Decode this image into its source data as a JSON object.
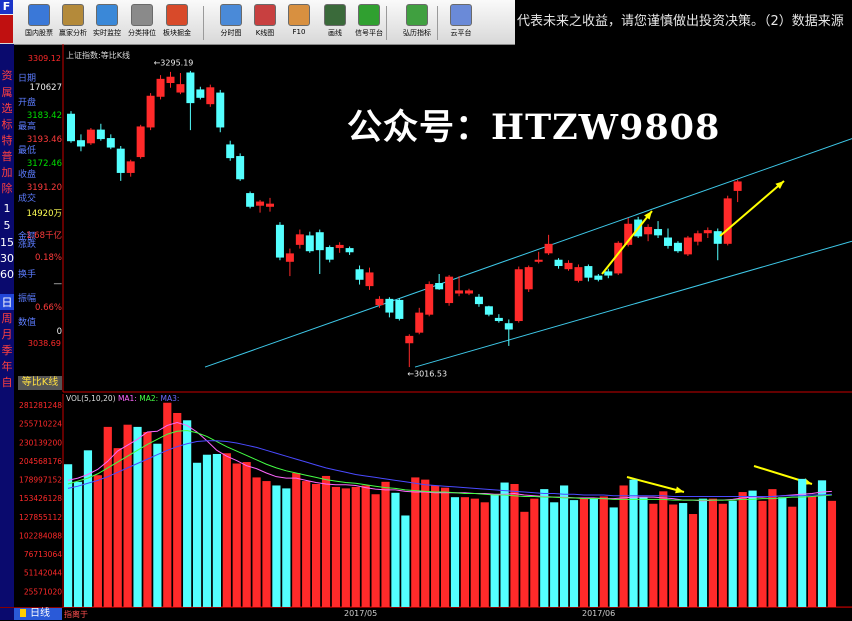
{
  "toolbar": {
    "buttons": [
      {
        "label": "国内股票",
        "icon": "monitor-icon"
      },
      {
        "label": "赢家分析",
        "icon": "calculator-icon"
      },
      {
        "label": "实时监控",
        "icon": "clock-icon"
      },
      {
        "label": "分类排位",
        "icon": "list-icon"
      },
      {
        "label": "板块掘金",
        "icon": "sector-icon"
      },
      {
        "label": "分时图",
        "icon": "intraday-icon"
      },
      {
        "label": "K线图",
        "icon": "candle-icon"
      },
      {
        "label": "F10",
        "icon": "document-icon"
      },
      {
        "label": "画线",
        "icon": "pencil-icon"
      },
      {
        "label": "信号平台",
        "icon": "traffic-light-icon"
      },
      {
        "label": "弘历指标",
        "icon": "indicator-icon"
      },
      {
        "label": "云平台",
        "icon": "cloud-icon"
      }
    ]
  },
  "ticker": "代表未来之收益，请您谨慎做出投资决策。（2）数据来源",
  "leftbar": {
    "items": [
      "资",
      "属",
      "选",
      "标",
      "特",
      "普",
      "加",
      "除",
      "1",
      "5",
      "15",
      "30",
      "60",
      "日",
      "周",
      "月",
      "季",
      "年",
      "自"
    ]
  },
  "info": {
    "labels": [
      "日期",
      "开盘",
      "最高",
      "最低",
      "收盘",
      "成交",
      "金额",
      "涨跌",
      "换手",
      "振幅",
      "数值"
    ],
    "date": "170627",
    "open": "3183.42",
    "high": "3193.46",
    "low": "3172.46",
    "close": "3191.20",
    "volume": "14920万",
    "amount": "1.68千亿",
    "change_pct": "0.18%",
    "turnover": "—",
    "amplitude": "0.66%",
    "value": "0"
  },
  "tabs": {
    "equal_ratio": "等比K线",
    "day": "日线",
    "bottom_label": "指离于"
  },
  "watermark": "公众号：HTZW9808",
  "chart_data": [
    {
      "type": "candlestick",
      "title": "上证指数:等比K线",
      "y_ticks": [
        "3309.12",
        "3038.69"
      ],
      "ylim": [
        3000,
        3309.12
      ],
      "annotations": [
        "3295.19",
        "3016.53"
      ],
      "x_ticks": [
        "2017/05",
        "2017/06"
      ],
      "candles": [
        {
          "o": 3255,
          "h": 3258,
          "l": 3228,
          "c": 3230
        },
        {
          "o": 3230,
          "h": 3236,
          "l": 3220,
          "c": 3225
        },
        {
          "o": 3228,
          "h": 3242,
          "l": 3226,
          "c": 3240
        },
        {
          "o": 3240,
          "h": 3246,
          "l": 3230,
          "c": 3232
        },
        {
          "o": 3232,
          "h": 3236,
          "l": 3222,
          "c": 3224
        },
        {
          "o": 3222,
          "h": 3225,
          "l": 3192,
          "c": 3200
        },
        {
          "o": 3200,
          "h": 3212,
          "l": 3196,
          "c": 3210
        },
        {
          "o": 3215,
          "h": 3245,
          "l": 3213,
          "c": 3243
        },
        {
          "o": 3243,
          "h": 3275,
          "l": 3240,
          "c": 3272
        },
        {
          "o": 3272,
          "h": 3292,
          "l": 3269,
          "c": 3288
        },
        {
          "o": 3285,
          "h": 3295,
          "l": 3280,
          "c": 3290
        },
        {
          "o": 3276,
          "h": 3294,
          "l": 3274,
          "c": 3283
        },
        {
          "o": 3294,
          "h": 3296,
          "l": 3240,
          "c": 3266
        },
        {
          "o": 3278,
          "h": 3281,
          "l": 3269,
          "c": 3271
        },
        {
          "o": 3265,
          "h": 3283,
          "l": 3262,
          "c": 3280
        },
        {
          "o": 3275,
          "h": 3278,
          "l": 3238,
          "c": 3243
        },
        {
          "o": 3226,
          "h": 3230,
          "l": 3211,
          "c": 3214
        },
        {
          "o": 3215,
          "h": 3218,
          "l": 3192,
          "c": 3194
        },
        {
          "o": 3180,
          "h": 3182,
          "l": 3166,
          "c": 3168
        },
        {
          "o": 3169,
          "h": 3174,
          "l": 3162,
          "c": 3172
        },
        {
          "o": 3168,
          "h": 3176,
          "l": 3163,
          "c": 3170
        },
        {
          "o": 3150,
          "h": 3153,
          "l": 3117,
          "c": 3120
        },
        {
          "o": 3116,
          "h": 3128,
          "l": 3102,
          "c": 3123
        },
        {
          "o": 3132,
          "h": 3146,
          "l": 3128,
          "c": 3141
        },
        {
          "o": 3140,
          "h": 3144,
          "l": 3124,
          "c": 3126
        },
        {
          "o": 3143,
          "h": 3146,
          "l": 3104,
          "c": 3127
        },
        {
          "o": 3129,
          "h": 3131,
          "l": 3115,
          "c": 3118
        },
        {
          "o": 3129,
          "h": 3134,
          "l": 3124,
          "c": 3131
        },
        {
          "o": 3128,
          "h": 3130,
          "l": 3122,
          "c": 3125
        },
        {
          "o": 3108,
          "h": 3112,
          "l": 3094,
          "c": 3099
        },
        {
          "o": 3093,
          "h": 3110,
          "l": 3089,
          "c": 3105
        },
        {
          "o": 3075,
          "h": 3083,
          "l": 3072,
          "c": 3080
        },
        {
          "o": 3080,
          "h": 3082,
          "l": 3063,
          "c": 3068
        },
        {
          "o": 3079,
          "h": 3081,
          "l": 3060,
          "c": 3062
        },
        {
          "o": 3039,
          "h": 3047,
          "l": 3016,
          "c": 3045
        },
        {
          "o": 3049,
          "h": 3072,
          "l": 3047,
          "c": 3067
        },
        {
          "o": 3066,
          "h": 3097,
          "l": 3064,
          "c": 3094
        },
        {
          "o": 3095,
          "h": 3104,
          "l": 3089,
          "c": 3090
        },
        {
          "o": 3077,
          "h": 3103,
          "l": 3074,
          "c": 3101
        },
        {
          "o": 3086,
          "h": 3102,
          "l": 3083,
          "c": 3088
        },
        {
          "o": 3086,
          "h": 3090,
          "l": 3084,
          "c": 3088
        },
        {
          "o": 3082,
          "h": 3085,
          "l": 3073,
          "c": 3076
        },
        {
          "o": 3073,
          "h": 3074,
          "l": 3064,
          "c": 3066
        },
        {
          "o": 3062,
          "h": 3066,
          "l": 3058,
          "c": 3060
        },
        {
          "o": 3057,
          "h": 3061,
          "l": 3036,
          "c": 3052
        },
        {
          "o": 3060,
          "h": 3111,
          "l": 3058,
          "c": 3108
        },
        {
          "o": 3090,
          "h": 3112,
          "l": 3087,
          "c": 3110
        },
        {
          "o": 3116,
          "h": 3125,
          "l": 3114,
          "c": 3117
        },
        {
          "o": 3124,
          "h": 3141,
          "l": 3122,
          "c": 3132
        },
        {
          "o": 3117,
          "h": 3119,
          "l": 3109,
          "c": 3112
        },
        {
          "o": 3109,
          "h": 3117,
          "l": 3107,
          "c": 3114
        },
        {
          "o": 3098,
          "h": 3113,
          "l": 3096,
          "c": 3110
        },
        {
          "o": 3111,
          "h": 3113,
          "l": 3097,
          "c": 3101
        },
        {
          "o": 3102,
          "h": 3104,
          "l": 3097,
          "c": 3099
        },
        {
          "o": 3106,
          "h": 3109,
          "l": 3100,
          "c": 3103
        },
        {
          "o": 3105,
          "h": 3135,
          "l": 3103,
          "c": 3133
        },
        {
          "o": 3132,
          "h": 3157,
          "l": 3130,
          "c": 3151
        },
        {
          "o": 3155,
          "h": 3158,
          "l": 3138,
          "c": 3140
        },
        {
          "o": 3142,
          "h": 3151,
          "l": 3135,
          "c": 3148
        },
        {
          "o": 3146,
          "h": 3154,
          "l": 3138,
          "c": 3141
        },
        {
          "o": 3138,
          "h": 3147,
          "l": 3128,
          "c": 3131
        },
        {
          "o": 3133,
          "h": 3135,
          "l": 3124,
          "c": 3126
        },
        {
          "o": 3123,
          "h": 3140,
          "l": 3121,
          "c": 3138
        },
        {
          "o": 3135,
          "h": 3145,
          "l": 3131,
          "c": 3142
        },
        {
          "o": 3143,
          "h": 3148,
          "l": 3138,
          "c": 3145
        },
        {
          "o": 3144,
          "h": 3147,
          "l": 3117,
          "c": 3133
        },
        {
          "o": 3133,
          "h": 3178,
          "l": 3131,
          "c": 3175
        },
        {
          "o": 3183,
          "h": 3193,
          "l": 3172,
          "c": 3191
        }
      ],
      "channel": {
        "upper": [
          [
            3038,
            3038
          ],
          [
            852,
            3232
          ]
        ],
        "lower": [
          [
            3038,
            3016
          ],
          [
            852,
            3155
          ]
        ]
      }
    },
    {
      "type": "bar",
      "title": "VOL(5,10,20)",
      "series_names": [
        "MA1",
        "MA2",
        "MA3"
      ],
      "y_ticks": [
        "281281248",
        "255710224",
        "230139200",
        "204568176",
        "178997152",
        "153426128",
        "127855112",
        "102284088",
        "76713064",
        "51142044",
        "25571020"
      ],
      "ylim": [
        0,
        281281248
      ],
      "values": [
        195,
        171,
        214,
        180,
        246,
        217,
        249,
        246,
        239,
        223,
        279,
        265,
        255,
        197,
        208,
        209,
        210,
        196,
        198,
        177,
        172,
        166,
        162,
        183,
        172,
        168,
        179,
        164,
        162,
        164,
        166,
        154,
        171,
        156,
        125,
        177,
        174,
        166,
        163,
        150,
        150,
        148,
        143,
        153,
        170,
        168,
        130,
        148,
        161,
        143,
        166,
        146,
        148,
        149,
        151,
        136,
        166,
        174,
        150,
        141,
        158,
        140,
        142,
        127,
        148,
        148,
        141,
        145,
        157,
        159,
        145,
        161,
        150,
        137,
        175,
        151,
        173,
        145
      ],
      "up": [
        false,
        false,
        false,
        true,
        true,
        true,
        true,
        false,
        true,
        false,
        true,
        true,
        false,
        false,
        false,
        false,
        true,
        true,
        true,
        true,
        true,
        false,
        false,
        true,
        true,
        true,
        true,
        true,
        true,
        true,
        true,
        true,
        true,
        false,
        false,
        true,
        true,
        true,
        true,
        false,
        true,
        true,
        true,
        false,
        false,
        true,
        true,
        true,
        false,
        false,
        false,
        false,
        true,
        false,
        true,
        false,
        true,
        false,
        false,
        true,
        true,
        true,
        false,
        true,
        false,
        true,
        true,
        false,
        true,
        false,
        true,
        true,
        false,
        true,
        false,
        true,
        false,
        true
      ],
      "ma": {
        "MA1": [
          173,
          176,
          181,
          188,
          199,
          213,
          221,
          229,
          239,
          240,
          248,
          252,
          248,
          239,
          227,
          214,
          206,
          200,
          193,
          189,
          183,
          178,
          176,
          176,
          173,
          170,
          168,
          167,
          167,
          166,
          163,
          161,
          160,
          160,
          158,
          157,
          157,
          156,
          156,
          156,
          156,
          155,
          155,
          154,
          154,
          155,
          153,
          152,
          151,
          150,
          150,
          149,
          149,
          149,
          148,
          148,
          149,
          150,
          150,
          150,
          149,
          148,
          146,
          146,
          145,
          146,
          146,
          147,
          149,
          150,
          150,
          151,
          152,
          153,
          154,
          155,
          157,
          158
        ],
        "MA2": [
          168,
          172,
          176,
          182,
          190,
          198,
          206,
          214,
          222,
          229,
          236,
          240,
          241,
          238,
          233,
          226,
          219,
          213,
          207,
          201,
          195,
          190,
          186,
          183,
          180,
          177,
          174,
          172,
          170,
          169,
          167,
          165,
          163,
          162,
          160,
          159,
          158,
          157,
          157,
          156,
          155,
          155,
          154,
          153,
          153,
          152,
          151,
          151,
          150,
          150,
          149,
          149,
          148,
          148,
          148,
          147,
          147,
          147,
          147,
          147,
          147,
          146,
          146,
          146,
          146,
          146,
          146,
          146,
          147,
          147,
          148,
          148,
          149,
          150,
          150,
          151,
          152,
          153
        ],
        "MA3": [
          162,
          165,
          169,
          173,
          178,
          184,
          190,
          196,
          202,
          208,
          214,
          219,
          223,
          226,
          227,
          227,
          226,
          224,
          221,
          218,
          214,
          210,
          206,
          202,
          198,
          194,
          190,
          187,
          184,
          181,
          179,
          177,
          175,
          173,
          171,
          169,
          167,
          166,
          165,
          164,
          163,
          162,
          161,
          160,
          159,
          158,
          157,
          156,
          155,
          155,
          154,
          154,
          153,
          153,
          153,
          152,
          152,
          152,
          152,
          152,
          152,
          151,
          151,
          151,
          151,
          151,
          151,
          151,
          151,
          151,
          151,
          151,
          152,
          152,
          152,
          153,
          153,
          154
        ]
      }
    }
  ],
  "colors": {
    "up": "#ff2a2a",
    "down": "#54ffff",
    "ma1": "#ff66ff",
    "ma2": "#44ff44",
    "ma3": "#4a4aff",
    "channel": "#3ec8e8",
    "arrow": "#ffff00",
    "axis_red": "#c80000"
  }
}
